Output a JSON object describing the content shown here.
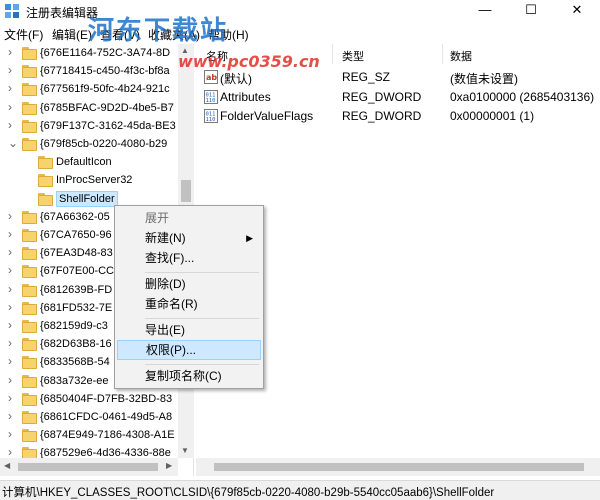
{
  "window": {
    "title": "注册表编辑器",
    "controls": {
      "minimize": "—",
      "maximize": "☐",
      "close": "✕"
    }
  },
  "menubar": [
    "文件(F)",
    "编辑(E)",
    "查看(V)",
    "收藏夹(A)",
    "帮助(H)"
  ],
  "watermark": {
    "logo": "河东下载站",
    "url": "www.pc0359.cn"
  },
  "tree": {
    "items": [
      {
        "label": "{676E1164-752C-3A74-8D",
        "expanded": false,
        "level": 0
      },
      {
        "label": "{67718415-c450-4f3c-bf8a",
        "expanded": false,
        "level": 0
      },
      {
        "label": "{677561f9-50fc-4b24-921c",
        "expanded": false,
        "level": 0
      },
      {
        "label": "{6785BFAC-9D2D-4be5-B7",
        "expanded": false,
        "level": 0
      },
      {
        "label": "{679F137C-3162-45da-BE3",
        "expanded": false,
        "level": 0
      },
      {
        "label": "{679f85cb-0220-4080-b29",
        "expanded": true,
        "level": 0
      },
      {
        "label": "DefaultIcon",
        "expanded": null,
        "level": 1
      },
      {
        "label": "InProcServer32",
        "expanded": null,
        "level": 1
      },
      {
        "label": "ShellFolder",
        "expanded": null,
        "level": 1,
        "selected": true
      },
      {
        "label": "{67A66362-05",
        "expanded": false,
        "level": 0
      },
      {
        "label": "{67CA7650-96",
        "expanded": false,
        "level": 0
      },
      {
        "label": "{67EA3D48-83",
        "expanded": false,
        "level": 0
      },
      {
        "label": "{67F07E00-CC",
        "expanded": false,
        "level": 0
      },
      {
        "label": "{6812639B-FD",
        "expanded": false,
        "level": 0
      },
      {
        "label": "{681FD532-7E",
        "expanded": false,
        "level": 0
      },
      {
        "label": "{682159d9-c3",
        "expanded": false,
        "level": 0
      },
      {
        "label": "{682D63B8-16",
        "expanded": false,
        "level": 0
      },
      {
        "label": "{6833568B-54",
        "expanded": false,
        "level": 0
      },
      {
        "label": "{683a732e-ee",
        "expanded": false,
        "level": 0
      },
      {
        "label": "{6850404F-D7FB-32BD-83",
        "expanded": false,
        "level": 0
      },
      {
        "label": "{6861CFDC-0461-49d5-A8",
        "expanded": false,
        "level": 0
      },
      {
        "label": "{6874E949-7186-4308-A1E",
        "expanded": false,
        "level": 0
      },
      {
        "label": "{687529e6-4d36-4336-88e",
        "expanded": false,
        "level": 0
      }
    ]
  },
  "list": {
    "columns": [
      "名称",
      "类型",
      "数据"
    ],
    "rows": [
      {
        "name": "(默认)",
        "type": "REG_SZ",
        "data": "(数值未设置)",
        "icon": "string-value-icon"
      },
      {
        "name": "Attributes",
        "type": "REG_DWORD",
        "data": "0xa0100000 (2685403136)",
        "icon": "binary-value-icon"
      },
      {
        "name": "FolderValueFlags",
        "type": "REG_DWORD",
        "data": "0x00000001 (1)",
        "icon": "binary-value-icon"
      }
    ]
  },
  "context_menu": {
    "items": [
      {
        "label": "展开",
        "disabled": true
      },
      {
        "label": "新建(N)",
        "submenu": true
      },
      {
        "label": "查找(F)..."
      },
      {
        "separator": true
      },
      {
        "label": "删除(D)"
      },
      {
        "label": "重命名(R)"
      },
      {
        "separator": true
      },
      {
        "label": "导出(E)"
      },
      {
        "label": "权限(P)...",
        "highlighted": true
      },
      {
        "separator": true
      },
      {
        "label": "复制项名称(C)"
      }
    ]
  },
  "statusbar": {
    "path": "计算机\\HKEY_CLASSES_ROOT\\CLSID\\{679f85cb-0220-4080-b29b-5540cc05aab6}\\ShellFolder"
  },
  "colors": {
    "selection": "#cce8ff",
    "menu_highlight": "#cde8ff",
    "folder": "#f7d36e",
    "menu_bg": "#f2f2f2"
  }
}
